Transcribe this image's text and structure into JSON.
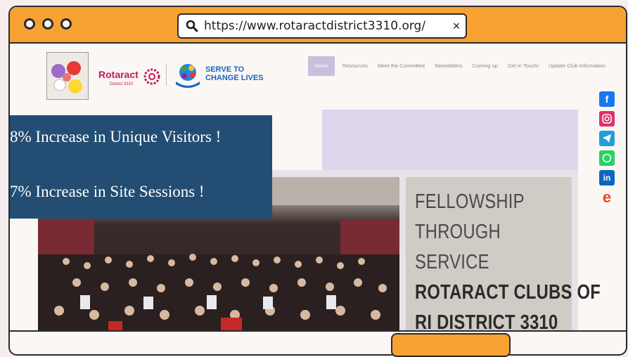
{
  "browser": {
    "url": "https://www.rotaractdistrict3310.org/",
    "close_symbol": "×"
  },
  "site": {
    "brand_name": "Rotaract",
    "brand_sub": "District 3310",
    "serve_line1": "SERVE TO",
    "serve_line2": "CHANGE LIVES",
    "nav": [
      "Home",
      "Resources",
      "Meet the Committee",
      "Newsletters",
      "Coming up",
      "Get in Touch!",
      "Update Club Information"
    ],
    "hero_lines": [
      "FELLOWSHIP",
      "THROUGH",
      "SERVICE",
      "ROTARACT CLUBS OF",
      "RI DISTRICT 3310"
    ],
    "social_icons": [
      "facebook-icon",
      "instagram-icon",
      "telegram-icon",
      "whatsapp-icon",
      "linkedin-icon",
      "e-icon"
    ]
  },
  "overlay": {
    "line1": "8% Increase in Unique Visitors !",
    "line2": "7% Increase in Site Sessions !"
  },
  "colors": {
    "accent_orange": "#f7a233",
    "overlay_blue": "#234d72",
    "nav_active": "#c9bfdb"
  }
}
